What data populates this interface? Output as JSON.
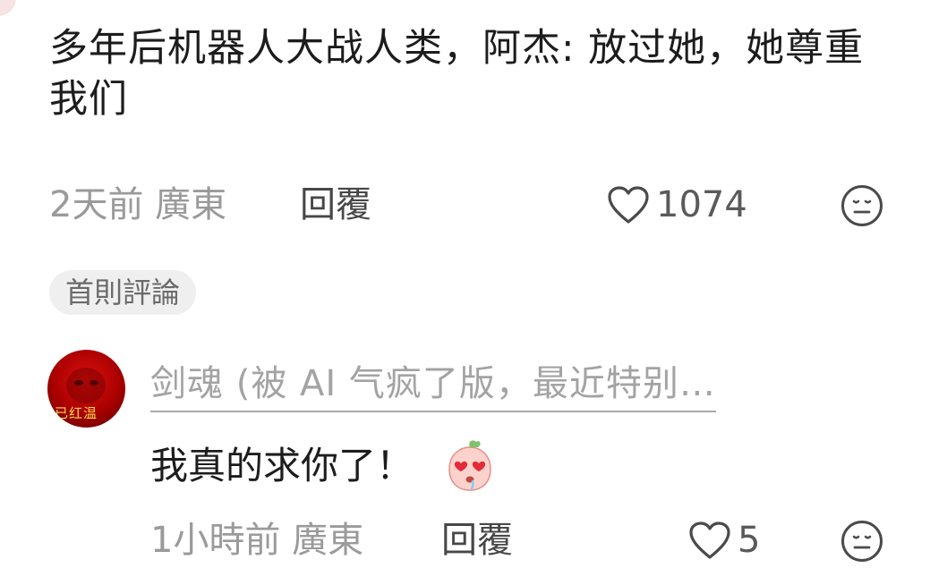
{
  "comment": {
    "text": "多年后机器人大战人类，阿杰: 放过她，她尊重我们",
    "time_location": "2天前 廣東",
    "reply_label": "回覆",
    "like_count": "1074"
  },
  "reply": {
    "badge": "首則評論",
    "avatar_text": "已红温",
    "author": "剑魂 (被 AI 气疯了版，最近特别…",
    "text": "我真的求你了！",
    "time_location": "1小時前 廣東",
    "reply_label": "回覆",
    "like_count": "5"
  },
  "icons": {
    "like": "heart-outline-icon",
    "emoji": "neutral-face-icon",
    "sticker": "heart-eyes-peach-sticker"
  },
  "colors": {
    "text_primary": "#1c1c1c",
    "text_secondary": "#9a9a9a",
    "avatar_red": "#c40000",
    "sticker_pink": "#f4a6a6"
  }
}
